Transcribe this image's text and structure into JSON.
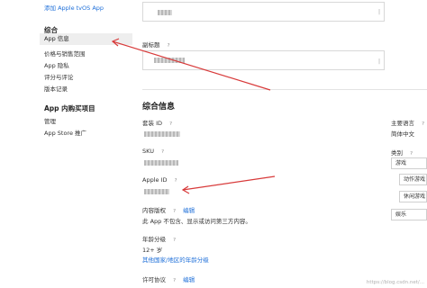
{
  "sidebar": {
    "top_link": "添加 Apple tvOS App",
    "general_heading": "综合",
    "general_items": [
      "App 信息",
      "价格与销售范围",
      "App 隐私",
      "评分与评论",
      "版本记录"
    ],
    "iap_heading": "App 内购买项目",
    "iap_items": [
      "管理",
      "App Store 推广"
    ]
  },
  "form": {
    "counter_name": "|",
    "subtitle_label": "副标题",
    "subtitle_help": "?",
    "counter_subtitle": "|",
    "general_info_title": "综合信息",
    "bundle_id_label": "套装 ID",
    "bundle_id_help": "?",
    "sku_label": "SKU",
    "sku_help": "?",
    "apple_id_label": "Apple ID",
    "apple_id_help": "?",
    "content_rights_label": "内容版权",
    "content_rights_help": "?",
    "content_rights_edit": "编辑",
    "content_rights_value": "此 App 不包含、显示或访问第三方内容。",
    "age_rating_label": "年龄分级",
    "age_rating_help": "?",
    "age_rating_value": "12+ 岁",
    "age_rating_link": "其他国家/地区的年龄分级",
    "license_label": "许可协议",
    "license_help": "?",
    "license_edit": "编辑"
  },
  "right_column": {
    "primary_language_label": "主要语言",
    "primary_language_help": "?",
    "primary_language_value": "简体中文",
    "category_label": "类别",
    "category_help": "?",
    "category_primary": "游戏",
    "category_sub1": "动作游戏",
    "category_sub2": "休闲游戏",
    "category_secondary": "娱乐"
  },
  "watermark": "https://blog.csdn.net/..."
}
